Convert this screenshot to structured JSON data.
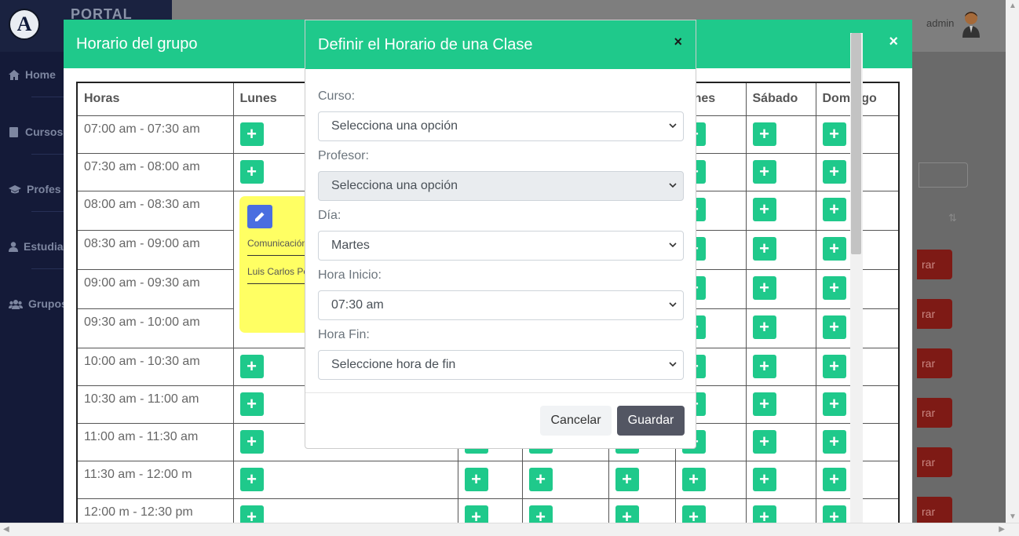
{
  "app": {
    "brand_letter": "A",
    "brand_text": "PORTAL",
    "user": "admin"
  },
  "sidebar": {
    "items": [
      {
        "label": "Home",
        "icon": "home-icon"
      },
      {
        "label": "Cursos",
        "icon": "book-icon"
      },
      {
        "label": "Profes",
        "icon": "graduation-cap-icon"
      },
      {
        "label": "Estudia",
        "icon": "user-icon"
      },
      {
        "label": "Grupos",
        "icon": "users-icon"
      }
    ]
  },
  "background": {
    "row_button_text": "rar",
    "sort_icon": "⇅"
  },
  "schedule_modal": {
    "title": "Horario del grupo",
    "close": "×",
    "headers": [
      "Horas",
      "Lunes",
      "",
      "",
      "",
      "ernes",
      "Sábado",
      "Domingo"
    ],
    "rows": [
      "07:00 am - 07:30 am",
      "07:30 am - 08:00 am",
      "08:00 am - 08:30 am",
      "08:30 am - 09:00 am",
      "09:00 am - 09:30 am",
      "09:30 am - 10:00 am",
      "10:00 am - 10:30 am",
      "10:30 am - 11:00 am",
      "11:00 am - 11:30 am",
      "11:30 am - 12:00 m",
      "12:00 m - 12:30 pm"
    ],
    "add_symbol": "+",
    "class_block": {
      "course": "Comunicación",
      "teacher": "Luis Carlos Pérez",
      "color": "#ffff63"
    }
  },
  "class_modal": {
    "title": "Definir el Horario de una Clase",
    "close": "×",
    "fields": {
      "curso": {
        "label": "Curso:",
        "value": "Selecciona una opción"
      },
      "profesor": {
        "label": "Profesor:",
        "value": "Selecciona una opción"
      },
      "dia": {
        "label": "Día:",
        "value": "Martes"
      },
      "hora_inicio": {
        "label": "Hora Inicio:",
        "value": "07:30 am"
      },
      "hora_fin": {
        "label": "Hora Fin:",
        "value": "Seleccione hora de fin"
      }
    },
    "cancel_label": "Cancelar",
    "save_label": "Guardar"
  },
  "colors": {
    "accent": "#1fc98b",
    "sidebar": "#141a38",
    "edit": "#4a6ee0",
    "danger": "#7e1a15",
    "save": "#535663"
  }
}
